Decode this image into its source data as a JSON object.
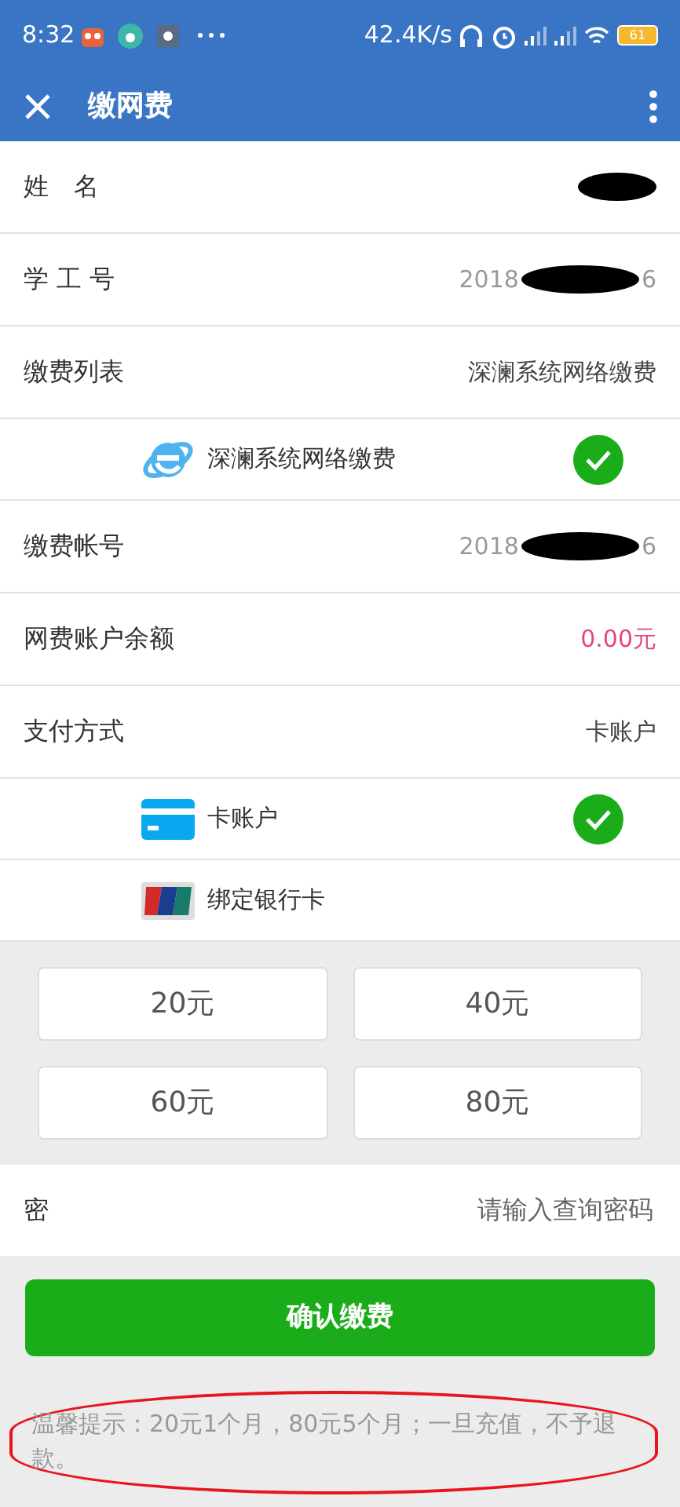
{
  "status_bar": {
    "time": "8:32",
    "speed": "42.4K/s",
    "battery": "61"
  },
  "header": {
    "title": "缴网费"
  },
  "info_rows": [
    {
      "label": "姓　名",
      "redacted": true
    },
    {
      "label": "学 工 号",
      "value_start": "2018",
      "value_end": "6",
      "redacted": true
    },
    {
      "label": "缴费列表",
      "value": "深澜系统网络缴费"
    }
  ],
  "fee_options": [
    {
      "label": "深澜系统网络缴费",
      "selected": true
    }
  ],
  "account_rows": [
    {
      "label": "缴费帐号",
      "value_start": "2018",
      "value_end": "6",
      "redacted": true
    },
    {
      "label": "网费账户余额",
      "value": "0.00元",
      "kind": "money"
    },
    {
      "label": "支付方式",
      "value": "卡账户"
    }
  ],
  "payment_methods": [
    {
      "label": "卡账户",
      "kind": "card",
      "selected": true
    },
    {
      "label": "绑定银行卡",
      "kind": "unionpay",
      "selected": false
    }
  ],
  "amounts": [
    "20元",
    "40元",
    "60元",
    "80元"
  ],
  "password": {
    "label": "密",
    "placeholder": "请输入查询密码"
  },
  "confirm_button": "确认缴费",
  "tip": {
    "text": "温馨提示：20元1个月，80元5个月；一旦充值，不予退款。",
    "circled": true
  }
}
